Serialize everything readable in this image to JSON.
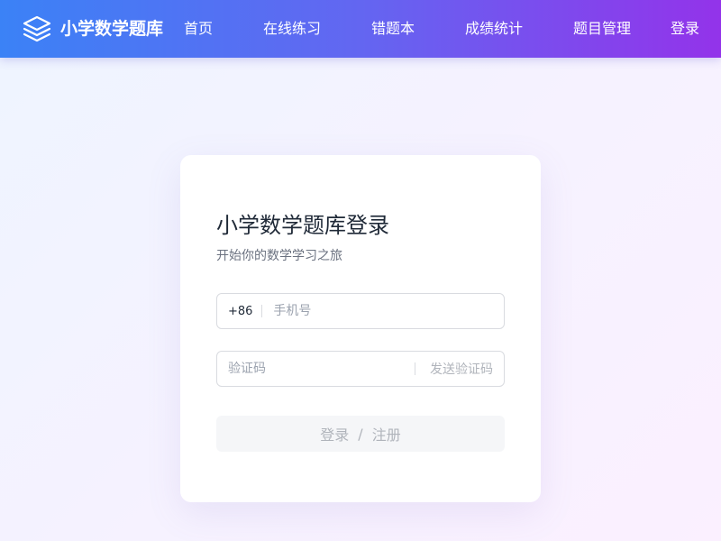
{
  "navbar": {
    "brand_icon": "layers-icon",
    "brand_name": "小学数学题库",
    "items": [
      {
        "label": "首页"
      },
      {
        "label": "在线练习"
      },
      {
        "label": "错题本"
      },
      {
        "label": "成绩统计"
      },
      {
        "label": "题目管理"
      }
    ],
    "login_label": "登录"
  },
  "login_card": {
    "title": "小学数学题库登录",
    "subtitle": "开始你的数学学习之旅",
    "phone": {
      "prefix": "+86",
      "value": "",
      "placeholder": "手机号"
    },
    "code": {
      "value": "",
      "placeholder": "验证码",
      "send_label": "发送验证码"
    },
    "submit": {
      "login_label": "登录",
      "separator": "/",
      "register_label": "注册"
    }
  },
  "colors": {
    "nav_gradient_start": "#3b82f6",
    "nav_gradient_end": "#9333ea",
    "disabled_text": "#b0b4bb"
  }
}
